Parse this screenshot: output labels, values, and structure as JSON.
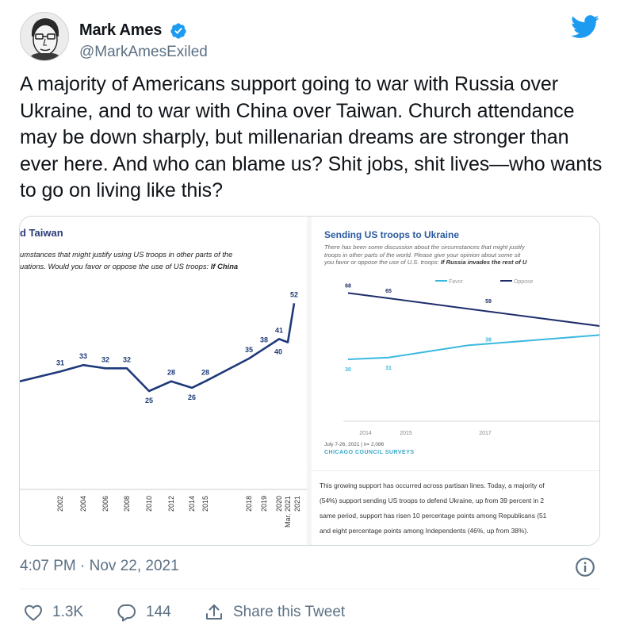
{
  "author": {
    "name": "Mark Ames",
    "handle": "@MarkAmesExiled"
  },
  "tweet": {
    "text": "A majority of Americans support going to war with Russia over Ukraine, and to war with China over Taiwan. Church attendance may be down sharply, but millenarian dreams are stronger than ever here. And who can blame us? Shit jobs, shit lives—who wants to go on living like this?"
  },
  "left_chart_text": {
    "title": "d Taiwan",
    "subtitle_line1": "umstances that might justify using US troops in other parts of the",
    "subtitle_line2_a": "uations. Would you favor or oppose the use of US troops: ",
    "subtitle_line2_b": "If China"
  },
  "right_chart_text": {
    "title": "Sending US troops to Ukraine",
    "subtitle_line1": "There has been some discussion about the circumstances that might justify",
    "subtitle_line2": "troops in other parts of the world. Please give your opinion about some sit",
    "subtitle_line3_a": "you favor or oppose the use of U.S. troops: ",
    "subtitle_line3_b": "If Russia invades the rest of U",
    "footnote": "July 7-26, 2021 | n= 2,086",
    "source": "CHICAGO COUNCIL SURVEYS",
    "body_line1": "This growing support has occurred across partisan lines. Today, a majority of",
    "body_line2": "(54%) support sending US troops to defend Ukraine, up from 39 percent in 2",
    "body_line3": "same period, support has risen 10 percentage points among Republicans (51",
    "body_line4": "and eight percentage points among Independents (46%, up from 38%)."
  },
  "chart_data": [
    {
      "type": "line",
      "title": "d Taiwan",
      "categories": [
        "",
        "2002",
        "2004",
        "2006",
        "2008",
        "2010",
        "2012",
        "2014",
        "2015",
        "2018",
        "2019",
        "2020",
        "Mar. 2021",
        "2021"
      ],
      "series": [
        {
          "values": [
            null,
            31,
            33,
            32,
            32,
            25,
            28,
            26,
            28,
            35,
            38,
            41,
            40,
            52
          ]
        }
      ],
      "first_label": "?",
      "colors": {
        "line": "#1f3a7a"
      }
    },
    {
      "type": "line",
      "title": "Sending US troops to Ukraine",
      "legend": [
        "Favor",
        "Oppose"
      ],
      "legend_position": "top",
      "x": [
        "2014",
        "2015",
        "2017"
      ],
      "series": [
        {
          "name": "Favor",
          "values": [
            30,
            31,
            38
          ]
        },
        {
          "name": "Oppose",
          "values": [
            68,
            65,
            59
          ]
        }
      ],
      "colors": {
        "favor": "#3bb8e0",
        "oppose": "#1f2e6b"
      }
    }
  ],
  "footer": {
    "timestamp": "4:07 PM · Nov 22, 2021",
    "likes": "1.3K",
    "replies": "144",
    "share_label": "Share this Tweet"
  },
  "colors": {
    "twitter_blue": "#1d9bf0",
    "secondary_text": "#5b7083"
  },
  "icons": [
    "avatar",
    "verified-badge-icon",
    "twitter-logo-icon",
    "info-icon",
    "heart-icon",
    "reply-icon",
    "share-icon"
  ]
}
